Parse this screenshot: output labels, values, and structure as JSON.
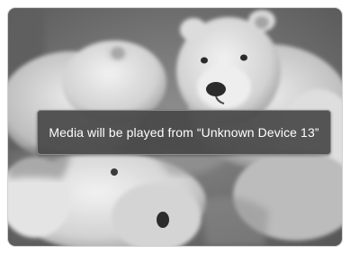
{
  "background": {
    "image_icon": "polar-bear-cubs-photo"
  },
  "notification": {
    "message": "Media will be played from “Unknown Device 13”"
  },
  "colors": {
    "toast_background": "#484848",
    "toast_border": "#8c8c8c",
    "toast_text": "#ffffff"
  }
}
